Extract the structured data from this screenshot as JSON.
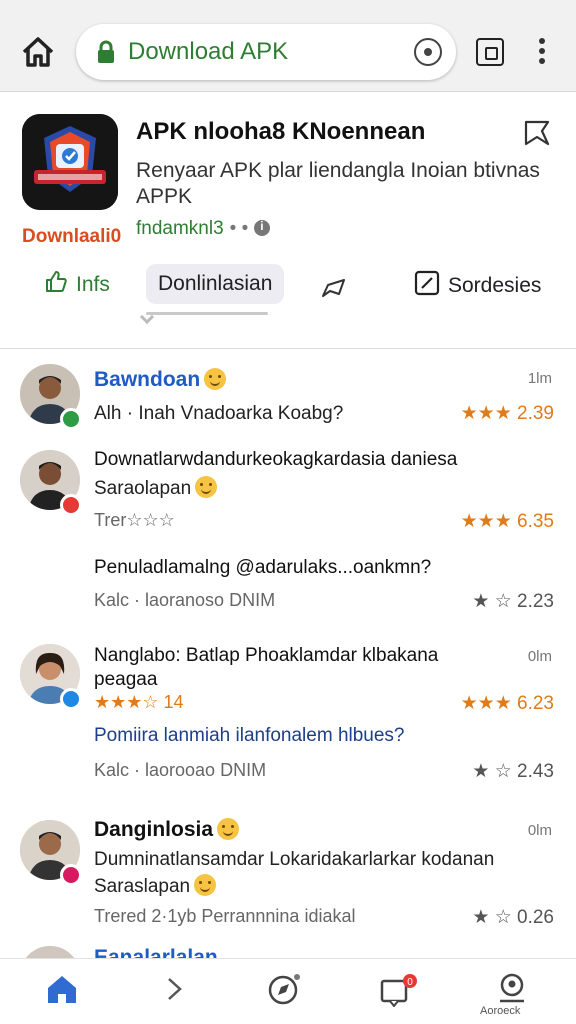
{
  "browser": {
    "url_prefix": "",
    "url": "Download APK"
  },
  "app": {
    "icon_caption": "Downlaali0",
    "title": "APK nlooha8 KNoennean",
    "description": "Renyaar APK plar liendangla Inoian btivnas APPK",
    "developer": "fndamknl3",
    "developer_dots": "• •"
  },
  "actions": {
    "info": "Infs",
    "download": "Donlinlasian",
    "settings": "Sordesies"
  },
  "reviews": [
    {
      "name": "Bawndoan",
      "text": "Alh · Inah Vnadoarka Koabg?",
      "time": "1lm",
      "rating": "★★★ 2.39"
    },
    {
      "name": "Downatlarwdandurkeokagkardasia daniesa",
      "text": "Saraolapan",
      "meta": "Trer☆☆☆",
      "rating": "★★★ 6.35"
    },
    {
      "name": "Penuladlamalng @adarulaks...oankmn?",
      "meta": "Kalc · laoranoso DNIM",
      "rating": "★ ☆ 2.23"
    },
    {
      "name": "Nanglabo: Batlap Phoaklamdar klbakana peagaa",
      "stars": "★★★☆ 14",
      "time": "0lm",
      "rating": "★★★ 6.23"
    },
    {
      "name": "Pomiira lanmiah ilanfonalem hlbues?",
      "meta": "Kalc · laorooao DNIM",
      "rating": "★ ☆ 2.43"
    },
    {
      "name": "Danginlosia",
      "text": "Dumninatlansamdar Lokaridakarlarkar kodanan",
      "text2": "Saraslapan",
      "time": "0lm",
      "meta": "Trered 2·1yb  Perrannnina idiakal",
      "rating": "★ ☆ 0.26"
    },
    {
      "name": "Eanalarlalan"
    }
  ],
  "nav": {
    "account_label": "Aoroeck",
    "notification_count": "0"
  },
  "colors": {
    "accent_green": "#2e7d32",
    "star_orange": "#e07b1a",
    "link_blue": "#1f5bc4"
  }
}
